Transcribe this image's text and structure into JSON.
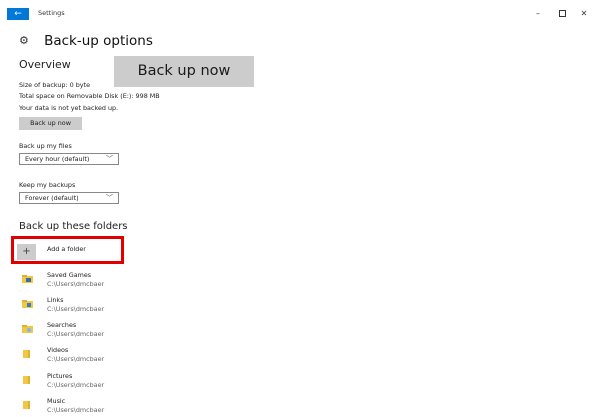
{
  "window": {
    "app_title": "Settings",
    "back_glyph": "←",
    "minimize_glyph": "–",
    "close_glyph": "✕"
  },
  "header": {
    "icon": "gear-icon",
    "title": "Back-up options"
  },
  "overview": {
    "heading": "Overview",
    "backup_size": "Size of backup: 0 byte",
    "total_space": "Total space on Removable Disk (E:): 998 MB",
    "status": "Your data is not yet backed up.",
    "backup_now_small": "Back up now",
    "backup_now_large": "Back up now"
  },
  "frequency": {
    "label": "Back up my files",
    "selected": "Every hour (default)"
  },
  "retention": {
    "label": "Keep my backups",
    "selected": "Forever (default)"
  },
  "folders": {
    "heading": "Back up these folders",
    "add_label": "Add a folder",
    "add_glyph": "+",
    "items": [
      {
        "name": "Saved Games",
        "path": "C:\\Users\\dmcbaer"
      },
      {
        "name": "Links",
        "path": "C:\\Users\\dmcbaer"
      },
      {
        "name": "Searches",
        "path": "C:\\Users\\dmcbaer"
      },
      {
        "name": "Videos",
        "path": "C:\\Users\\dmcbaer"
      },
      {
        "name": "Pictures",
        "path": "C:\\Users\\dmcbaer"
      },
      {
        "name": "Music",
        "path": "C:\\Users\\dmcbaer"
      }
    ]
  },
  "colors": {
    "accent": "#0078d7",
    "highlight": "#e00000",
    "button_bg": "#cccccc",
    "folder_yellow": "#f2c744"
  }
}
